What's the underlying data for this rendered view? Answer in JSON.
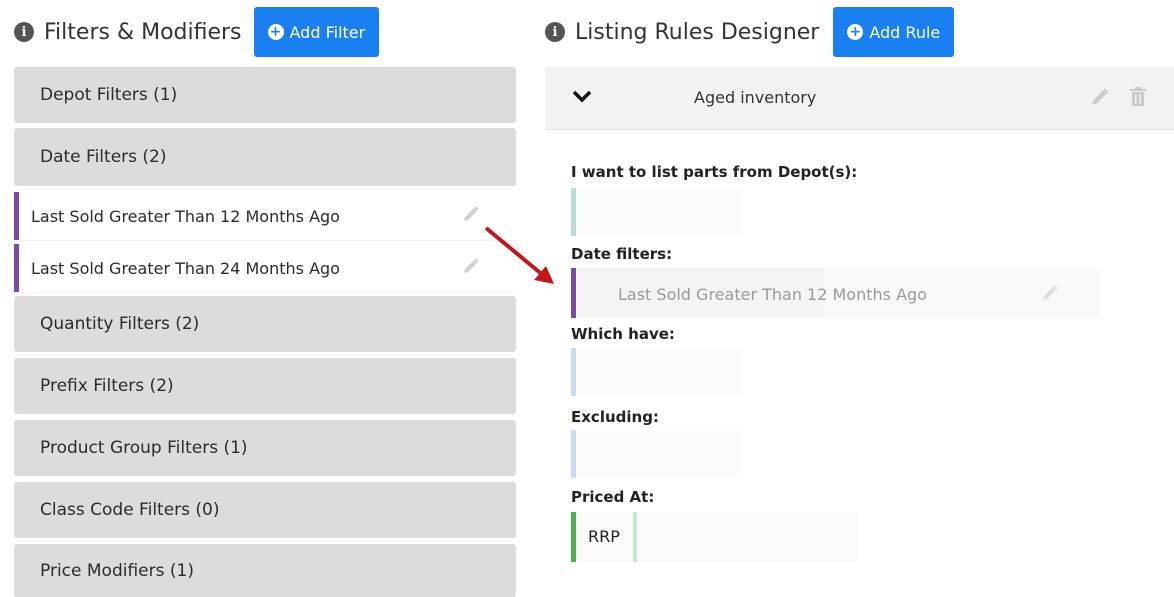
{
  "left": {
    "title": "Filters & Modifiers",
    "add_button": "Add Filter",
    "groups": [
      "Depot Filters (1)",
      "Date Filters (2)",
      "Quantity Filters (2)",
      "Prefix Filters (2)",
      "Product Group Filters (1)",
      "Class Code Filters (0)",
      "Price Modifiers (1)"
    ],
    "date_filters": [
      "Last Sold Greater Than 12 Months Ago",
      "Last Sold Greater Than 24 Months Ago"
    ]
  },
  "right": {
    "title": "Listing Rules Designer",
    "add_button": "Add Rule",
    "rule_name": "Aged inventory",
    "labels": {
      "depots": "I want to list parts from Depot(s):",
      "date": "Date filters:",
      "which_have": "Which have:",
      "excluding": "Excluding:",
      "priced_at": "Priced At:"
    },
    "dragged_item": "Last Sold Greater Than 12 Months Ago",
    "price_value": "RRP"
  },
  "colors": {
    "primary": "#1a7ff0",
    "accordion_bg": "#dcdcdc",
    "date_accent": "#7b4aa6",
    "price_accent": "#4caf50",
    "arrow": "#c0161c"
  }
}
